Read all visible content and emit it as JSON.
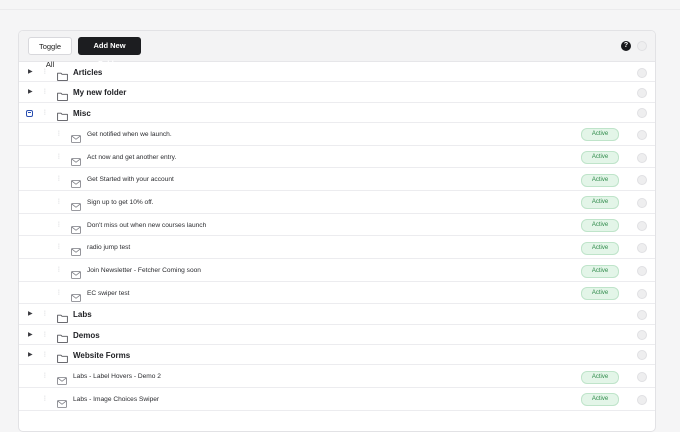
{
  "toolbar": {
    "toggle_all_label": "Toggle All",
    "add_folder_label": "Add New Folder",
    "help_glyph": "?"
  },
  "folders_top": [
    {
      "name": "Articles",
      "expanded": false
    },
    {
      "name": "My new folder",
      "expanded": false
    },
    {
      "name": "Misc",
      "expanded": true
    }
  ],
  "misc_items": [
    {
      "name": "Get notified when we launch.",
      "status": "Active"
    },
    {
      "name": "Act now and get another entry.",
      "status": "Active"
    },
    {
      "name": "Get Started with your account",
      "status": "Active"
    },
    {
      "name": "Sign up to get 10% off.",
      "status": "Active"
    },
    {
      "name": "Don't miss out when new courses launch",
      "status": "Active"
    },
    {
      "name": "radio jump test",
      "status": "Active"
    },
    {
      "name": "Join Newsletter - Fetcher Coming soon",
      "status": "Active"
    },
    {
      "name": "EC swiper test",
      "status": "Active"
    }
  ],
  "folders_bottom": [
    {
      "name": "Labs",
      "expanded": false
    },
    {
      "name": "Demos",
      "expanded": false
    },
    {
      "name": "Website Forms",
      "expanded": true
    }
  ],
  "website_forms_items": [
    {
      "name": "Labs - Label Hovers - Demo 2",
      "status": "Active"
    },
    {
      "name": "Labs - Image Choices Swiper",
      "status": "Active"
    }
  ],
  "icons": {
    "caret": "caret-right-icon",
    "folder": "folder-icon",
    "envelope": "envelope-icon",
    "grip": "drag-handle-icon",
    "help": "help-icon"
  },
  "colors": {
    "active_badge_bg": "#e3f5e8",
    "active_badge_text": "#2f8a4a",
    "primary_button": "#1c1d20"
  }
}
